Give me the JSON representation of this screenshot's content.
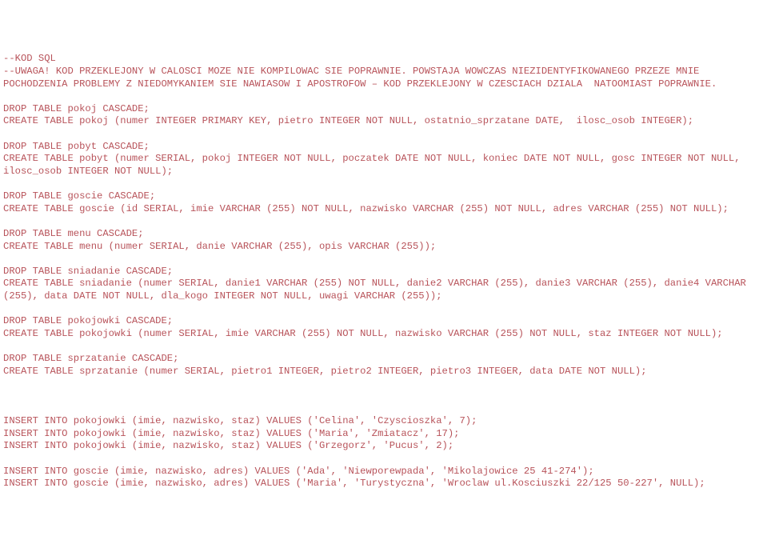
{
  "sql": {
    "header_comment": "--KOD SQL\n--UWAGA! KOD PRZEKLEJONY W CALOSCI MOZE NIE KOMPILOWAC SIE POPRAWNIE. POWSTAJA WOWCZAS NIEZIDENTYFIKOWANEGO PRZEZE MNIE POCHODZENIA PROBLEMY Z NIEDOMYKANIEM SIE NAWIASOW I APOSTROFOW – KOD PRZEKLEJONY W CZESCIACH DZIALA  NATOOMIAST POPRAWNIE.",
    "blocks": [
      "DROP TABLE pokoj CASCADE;\nCREATE TABLE pokoj (numer INTEGER PRIMARY KEY, pietro INTEGER NOT NULL, ostatnio_sprzatane DATE,  ilosc_osob INTEGER);",
      "DROP TABLE pobyt CASCADE;\nCREATE TABLE pobyt (numer SERIAL, pokoj INTEGER NOT NULL, poczatek DATE NOT NULL, koniec DATE NOT NULL, gosc INTEGER NOT NULL, ilosc_osob INTEGER NOT NULL);",
      "DROP TABLE goscie CASCADE;\nCREATE TABLE goscie (id SERIAL, imie VARCHAR (255) NOT NULL, nazwisko VARCHAR (255) NOT NULL, adres VARCHAR (255) NOT NULL);",
      "DROP TABLE menu CASCADE;\nCREATE TABLE menu (numer SERIAL, danie VARCHAR (255), opis VARCHAR (255));",
      "DROP TABLE sniadanie CASCADE;\nCREATE TABLE sniadanie (numer SERIAL, danie1 VARCHAR (255) NOT NULL, danie2 VARCHAR (255), danie3 VARCHAR (255), danie4 VARCHAR (255), data DATE NOT NULL, dla_kogo INTEGER NOT NULL, uwagi VARCHAR (255));",
      "DROP TABLE pokojowki CASCADE;\nCREATE TABLE pokojowki (numer SERIAL, imie VARCHAR (255) NOT NULL, nazwisko VARCHAR (255) NOT NULL, staz INTEGER NOT NULL);",
      "DROP TABLE sprzatanie CASCADE;\nCREATE TABLE sprzatanie (numer SERIAL, pietro1 INTEGER, pietro2 INTEGER, pietro3 INTEGER, data DATE NOT NULL);"
    ],
    "inserts_pokojowki": [
      "INSERT INTO pokojowki (imie, nazwisko, staz) VALUES ('Celina', 'Czyscioszka', 7);",
      "INSERT INTO pokojowki (imie, nazwisko, staz) VALUES ('Maria', 'Zmiatacz', 17);",
      "INSERT INTO pokojowki (imie, nazwisko, staz) VALUES ('Grzegorz', 'Pucus', 2);"
    ],
    "inserts_goscie": [
      "INSERT INTO goscie (imie, nazwisko, adres) VALUES ('Ada', 'Niewporewpada', 'Mikolajowice 25 41-274');",
      "INSERT INTO goscie (imie, nazwisko, adres) VALUES ('Maria', 'Turystyczna', 'Wroclaw ul.Kosciuszki 22/125 50-227', NULL);"
    ]
  }
}
